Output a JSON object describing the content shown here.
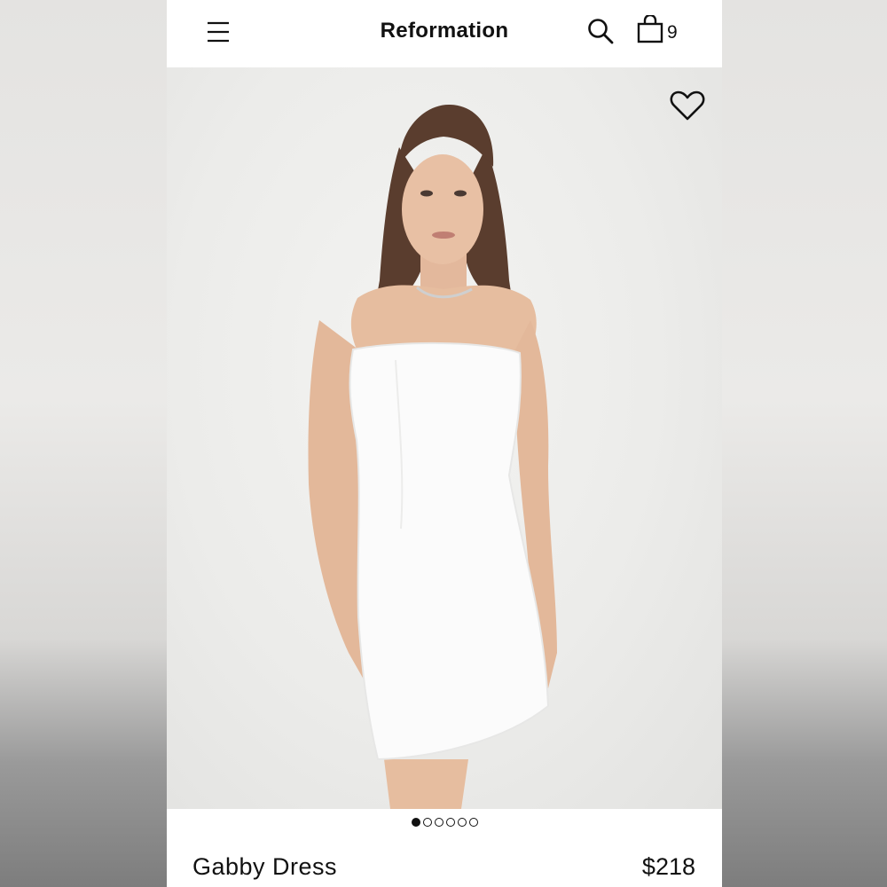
{
  "header": {
    "brand": "Reformation",
    "bag_count": "9",
    "menu_icon": "hamburger-menu-icon",
    "search_icon": "search-icon",
    "bag_icon": "shopping-bag-icon"
  },
  "gallery": {
    "favorite_icon": "heart-icon",
    "image_count": 6,
    "active_index": 0
  },
  "product": {
    "name": "Gabby Dress",
    "price": "$218"
  },
  "colors": {
    "text": "#111111",
    "background": "#ffffff",
    "photo_bg": "#ececea"
  }
}
